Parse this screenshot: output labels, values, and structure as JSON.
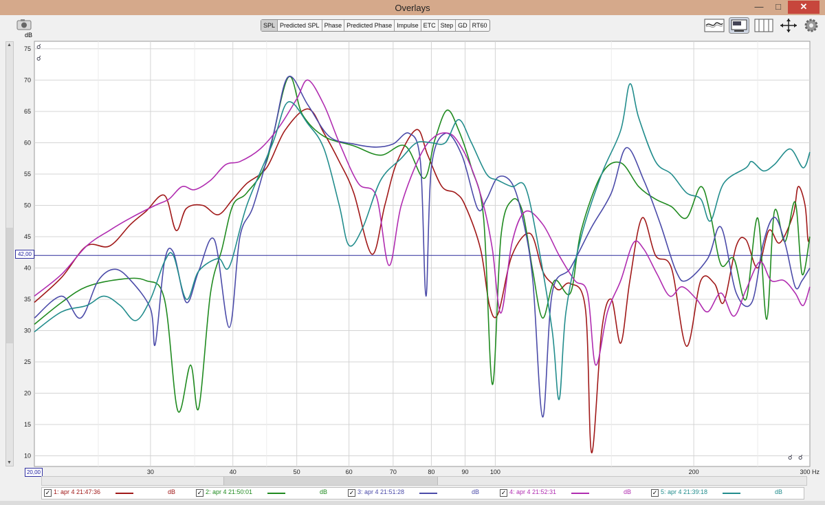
{
  "window": {
    "title": "Overlays"
  },
  "tabs": [
    {
      "label": "SPL",
      "active": true
    },
    {
      "label": "Predicted SPL",
      "active": false
    },
    {
      "label": "Phase",
      "active": false
    },
    {
      "label": "Predicted Phase",
      "active": false
    },
    {
      "label": "Impulse",
      "active": false
    },
    {
      "label": "ETC",
      "active": false
    },
    {
      "label": "Step",
      "active": false
    },
    {
      "label": "GD",
      "active": false
    },
    {
      "label": "RT60",
      "active": false
    }
  ],
  "readouts": {
    "cursor_value": "42,00",
    "start_freq": "20,00",
    "y_unit": "dB",
    "x_unit": "Hz"
  },
  "chart_data": {
    "type": "line",
    "xlabel": "Hz",
    "ylabel": "dB",
    "xscale": "log",
    "xlim": [
      20,
      300
    ],
    "ylim": [
      8.3,
      76.2
    ],
    "grid": true,
    "y_ticks": [
      75,
      70,
      65,
      60,
      55,
      50,
      45,
      40,
      35,
      30,
      25,
      20,
      15,
      10
    ],
    "x_ticks": [
      30,
      40,
      50,
      60,
      70,
      80,
      90,
      100,
      200
    ],
    "x_tick_labels": [
      "30",
      "40",
      "50",
      "60",
      "70",
      "80",
      "90",
      "100",
      "200",
      "300 Hz"
    ],
    "cursor_line": 42,
    "series": [
      {
        "name": "1: apr 4 21:47:36",
        "unit": "dB",
        "color": "#a01818",
        "points": [
          [
            20,
            34.5
          ],
          [
            22,
            38.5
          ],
          [
            24,
            43.5
          ],
          [
            26,
            43.5
          ],
          [
            28,
            47
          ],
          [
            29.5,
            49
          ],
          [
            31.5,
            51.6
          ],
          [
            32.8,
            46
          ],
          [
            34,
            49.5
          ],
          [
            36,
            50
          ],
          [
            38,
            48.5
          ],
          [
            40,
            51
          ],
          [
            42,
            53.5
          ],
          [
            45,
            56
          ],
          [
            48,
            62
          ],
          [
            52,
            65.4
          ],
          [
            55,
            61.5
          ],
          [
            58,
            57
          ],
          [
            61,
            52
          ],
          [
            65,
            42.2
          ],
          [
            68,
            50
          ],
          [
            71,
            57
          ],
          [
            76,
            62.1
          ],
          [
            79,
            58
          ],
          [
            83,
            53
          ],
          [
            87,
            52
          ],
          [
            90,
            50
          ],
          [
            95,
            43
          ],
          [
            98,
            34
          ],
          [
            101,
            32.7
          ],
          [
            106,
            42
          ],
          [
            113,
            45.5
          ],
          [
            118,
            39.5
          ],
          [
            122,
            37.5
          ],
          [
            125,
            36.5
          ],
          [
            130,
            37.5
          ],
          [
            137,
            33.5
          ],
          [
            140,
            10.5
          ],
          [
            145,
            30
          ],
          [
            150,
            35
          ],
          [
            155,
            28
          ],
          [
            160,
            38
          ],
          [
            167,
            48
          ],
          [
            175,
            42
          ],
          [
            185,
            40
          ],
          [
            195,
            27.5
          ],
          [
            205,
            38
          ],
          [
            215,
            37.5
          ],
          [
            222,
            34.5
          ],
          [
            232,
            43.5
          ],
          [
            240,
            44.5
          ],
          [
            250,
            40
          ],
          [
            260,
            46
          ],
          [
            270,
            44
          ],
          [
            283,
            48.5
          ],
          [
            288,
            53
          ],
          [
            295,
            50
          ],
          [
            298,
            44.5
          ],
          [
            300,
            45
          ]
        ]
      },
      {
        "name": "2: apr 4 21:50:01",
        "unit": "dB",
        "color": "#1f8a1f",
        "points": [
          [
            20,
            31
          ],
          [
            22,
            34.5
          ],
          [
            24,
            37
          ],
          [
            27,
            38.2
          ],
          [
            29.5,
            38
          ],
          [
            31.5,
            35
          ],
          [
            33,
            17.2
          ],
          [
            34.5,
            24.5
          ],
          [
            35.5,
            17.6
          ],
          [
            37,
            36
          ],
          [
            38.5,
            43
          ],
          [
            40,
            50
          ],
          [
            42,
            52
          ],
          [
            45,
            57
          ],
          [
            48.5,
            70.4
          ],
          [
            51,
            64.5
          ],
          [
            55,
            61
          ],
          [
            61,
            59.5
          ],
          [
            67,
            58
          ],
          [
            73,
            59.5
          ],
          [
            78,
            54.3
          ],
          [
            81,
            60.5
          ],
          [
            84.5,
            65.2
          ],
          [
            88,
            62
          ],
          [
            92,
            56
          ],
          [
            96,
            48
          ],
          [
            99,
            21.4
          ],
          [
            102,
            45
          ],
          [
            106,
            50.8
          ],
          [
            110,
            49
          ],
          [
            114,
            39.5
          ],
          [
            118,
            32
          ],
          [
            123,
            38
          ],
          [
            130,
            36
          ],
          [
            135,
            46
          ],
          [
            145,
            55
          ],
          [
            155,
            56.8
          ],
          [
            165,
            53
          ],
          [
            175,
            51
          ],
          [
            185,
            49.8
          ],
          [
            195,
            48
          ],
          [
            205,
            53
          ],
          [
            212,
            48.5
          ],
          [
            220,
            40.5
          ],
          [
            230,
            41.5
          ],
          [
            240,
            35
          ],
          [
            250,
            48
          ],
          [
            258,
            31.8
          ],
          [
            265,
            49
          ],
          [
            275,
            44.2
          ],
          [
            285,
            50.5
          ],
          [
            292,
            39
          ],
          [
            300,
            45
          ]
        ]
      },
      {
        "name": "3: apr 4 21:51:28",
        "unit": "dB",
        "color": "#4a4aa8",
        "points": [
          [
            20,
            32
          ],
          [
            22,
            35.5
          ],
          [
            23.5,
            32
          ],
          [
            25,
            38
          ],
          [
            26.5,
            39.8
          ],
          [
            28,
            38
          ],
          [
            30,
            33.5
          ],
          [
            30.5,
            27.8
          ],
          [
            31.5,
            41
          ],
          [
            32.5,
            42.5
          ],
          [
            34,
            34.5
          ],
          [
            35.5,
            39.5
          ],
          [
            37.5,
            44.5
          ],
          [
            39.5,
            30.5
          ],
          [
            41,
            45
          ],
          [
            43,
            50
          ],
          [
            46,
            61
          ],
          [
            48.5,
            70.5
          ],
          [
            52,
            66
          ],
          [
            56,
            61
          ],
          [
            61,
            59.8
          ],
          [
            66,
            59.3
          ],
          [
            70,
            59.8
          ],
          [
            74,
            61.5
          ],
          [
            77,
            57
          ],
          [
            78.5,
            35.5
          ],
          [
            80,
            56
          ],
          [
            84,
            61.5
          ],
          [
            89,
            58
          ],
          [
            94,
            49.5
          ],
          [
            97,
            51
          ],
          [
            101,
            54.5
          ],
          [
            106,
            53.5
          ],
          [
            110,
            48
          ],
          [
            114,
            38
          ],
          [
            118,
            16.2
          ],
          [
            122,
            36
          ],
          [
            130,
            40
          ],
          [
            140,
            46.5
          ],
          [
            150,
            52
          ],
          [
            158,
            59.2
          ],
          [
            168,
            54
          ],
          [
            178,
            47
          ],
          [
            188,
            39.5
          ],
          [
            195,
            38
          ],
          [
            210,
            41.5
          ],
          [
            220,
            46.5
          ],
          [
            232,
            36
          ],
          [
            245,
            34.5
          ],
          [
            255,
            44
          ],
          [
            265,
            48.1
          ],
          [
            275,
            44
          ],
          [
            285,
            37
          ],
          [
            292,
            38
          ],
          [
            300,
            40
          ]
        ]
      },
      {
        "name": "4: apr 4 21:52:31",
        "unit": "dB",
        "color": "#b02cb0",
        "points": [
          [
            20,
            35.5
          ],
          [
            22,
            39
          ],
          [
            24,
            43.5
          ],
          [
            26,
            46
          ],
          [
            28,
            48
          ],
          [
            30.5,
            50
          ],
          [
            32,
            51
          ],
          [
            33.5,
            53
          ],
          [
            35,
            52.5
          ],
          [
            37,
            54
          ],
          [
            39,
            56.5
          ],
          [
            41,
            57
          ],
          [
            44,
            59
          ],
          [
            47,
            62.5
          ],
          [
            50,
            67
          ],
          [
            52,
            70
          ],
          [
            55,
            66
          ],
          [
            58,
            60
          ],
          [
            62,
            53.5
          ],
          [
            66,
            51.5
          ],
          [
            69,
            40.4
          ],
          [
            72,
            50
          ],
          [
            77,
            58
          ],
          [
            81,
            61
          ],
          [
            85,
            61.5
          ],
          [
            88,
            60
          ],
          [
            92,
            56
          ],
          [
            96,
            50
          ],
          [
            99,
            43
          ],
          [
            102,
            32.8
          ],
          [
            106,
            44
          ],
          [
            111,
            49
          ],
          [
            118,
            47
          ],
          [
            125,
            42
          ],
          [
            132,
            38
          ],
          [
            138,
            36
          ],
          [
            142,
            24.5
          ],
          [
            148,
            33
          ],
          [
            155,
            38
          ],
          [
            162,
            44
          ],
          [
            168,
            43
          ],
          [
            176,
            39
          ],
          [
            184,
            35.5
          ],
          [
            192,
            37
          ],
          [
            202,
            35
          ],
          [
            210,
            33
          ],
          [
            220,
            36
          ],
          [
            230,
            32.3
          ],
          [
            240,
            36.5
          ],
          [
            252,
            41
          ],
          [
            262,
            38
          ],
          [
            274,
            38
          ],
          [
            285,
            36
          ],
          [
            293,
            34
          ],
          [
            300,
            37
          ]
        ]
      },
      {
        "name": "5: apr 4 21:39:18",
        "unit": "dB",
        "color": "#218c8c",
        "points": [
          [
            20,
            29.8
          ],
          [
            22,
            33
          ],
          [
            24,
            34
          ],
          [
            25.5,
            35.5
          ],
          [
            27,
            34
          ],
          [
            28.5,
            31.6
          ],
          [
            30,
            35
          ],
          [
            31.5,
            41
          ],
          [
            32.5,
            42
          ],
          [
            34,
            35
          ],
          [
            35.5,
            39.5
          ],
          [
            38,
            41.5
          ],
          [
            39.5,
            40.2
          ],
          [
            42,
            50
          ],
          [
            46,
            60
          ],
          [
            48.5,
            66.5
          ],
          [
            52,
            63
          ],
          [
            55,
            59
          ],
          [
            58,
            50
          ],
          [
            60,
            43.6
          ],
          [
            63,
            46.5
          ],
          [
            67,
            54
          ],
          [
            72,
            57.5
          ],
          [
            76,
            60
          ],
          [
            80,
            60
          ],
          [
            84,
            60
          ],
          [
            88,
            63.7
          ],
          [
            92,
            60
          ],
          [
            97,
            55
          ],
          [
            101,
            54
          ],
          [
            106,
            53
          ],
          [
            111,
            53
          ],
          [
            116,
            44
          ],
          [
            122,
            30
          ],
          [
            125,
            19
          ],
          [
            128,
            33
          ],
          [
            135,
            45
          ],
          [
            145,
            55
          ],
          [
            155,
            62
          ],
          [
            160,
            69.4
          ],
          [
            165,
            64
          ],
          [
            175,
            57
          ],
          [
            185,
            55
          ],
          [
            195,
            52
          ],
          [
            205,
            51
          ],
          [
            212,
            47.5
          ],
          [
            222,
            53.5
          ],
          [
            240,
            56
          ],
          [
            245,
            57
          ],
          [
            255,
            55.5
          ],
          [
            265,
            56.5
          ],
          [
            280,
            59
          ],
          [
            293,
            56
          ],
          [
            300,
            58.5
          ]
        ]
      }
    ]
  }
}
